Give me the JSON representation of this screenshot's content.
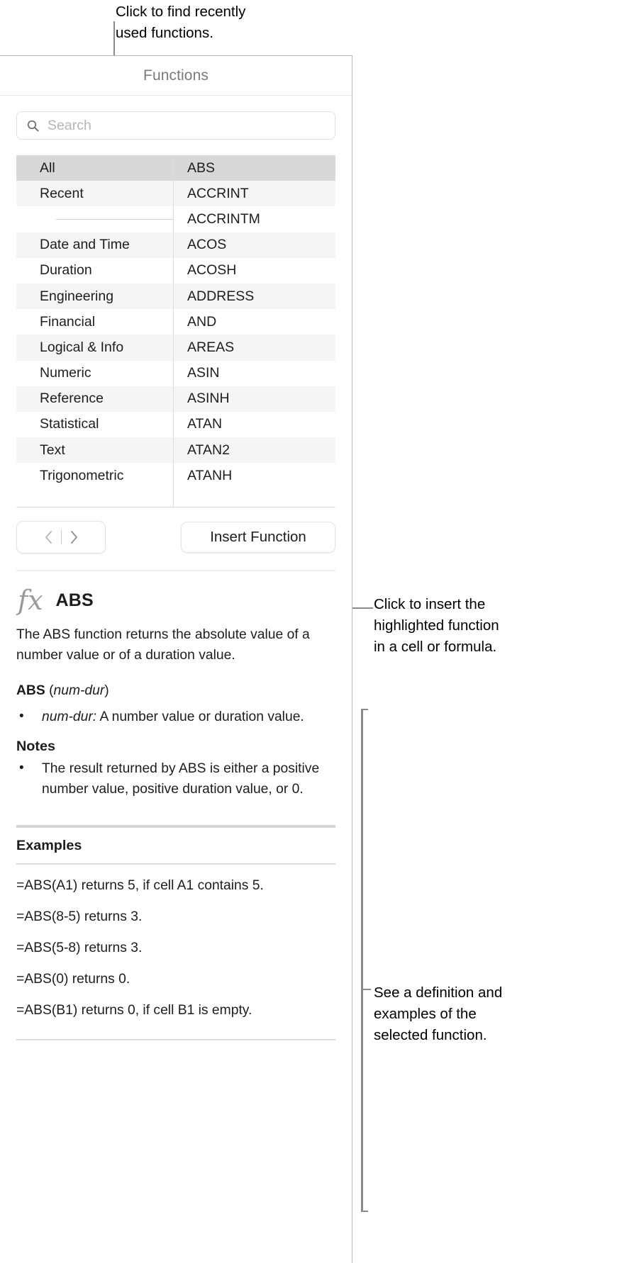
{
  "callouts": [
    {
      "id": "recent",
      "text": "Click to find recently\nused functions."
    },
    {
      "id": "insert",
      "text": "Click to insert the\nhighlighted function\nin a cell or formula."
    },
    {
      "id": "definition",
      "text": "See a definition and\nexamples of the\nselected function."
    }
  ],
  "panel": {
    "title": "Functions",
    "search": {
      "placeholder": "Search",
      "value": "",
      "icon": "search-icon"
    },
    "categories": [
      {
        "label": "All",
        "selected": true
      },
      {
        "label": "Recent",
        "selected": false
      },
      {
        "label": "",
        "separator": true
      },
      {
        "label": "Date and Time",
        "selected": false
      },
      {
        "label": "Duration",
        "selected": false
      },
      {
        "label": "Engineering",
        "selected": false
      },
      {
        "label": "Financial",
        "selected": false
      },
      {
        "label": "Logical & Info",
        "selected": false
      },
      {
        "label": "Numeric",
        "selected": false
      },
      {
        "label": "Reference",
        "selected": false
      },
      {
        "label": "Statistical",
        "selected": false
      },
      {
        "label": "Text",
        "selected": false
      },
      {
        "label": "Trigonometric",
        "selected": false
      }
    ],
    "functions": [
      {
        "label": "ABS",
        "selected": true
      },
      {
        "label": "ACCRINT",
        "selected": false
      },
      {
        "label": "ACCRINTM",
        "selected": false
      },
      {
        "label": "ACOS",
        "selected": false
      },
      {
        "label": "ACOSH",
        "selected": false
      },
      {
        "label": "ADDRESS",
        "selected": false
      },
      {
        "label": "AND",
        "selected": false
      },
      {
        "label": "AREAS",
        "selected": false
      },
      {
        "label": "ASIN",
        "selected": false
      },
      {
        "label": "ASINH",
        "selected": false
      },
      {
        "label": "ATAN",
        "selected": false
      },
      {
        "label": "ATAN2",
        "selected": false
      },
      {
        "label": "ATANH",
        "selected": false
      }
    ],
    "nav": {
      "back_icon": "chevron-left-icon",
      "forward_icon": "chevron-right-icon"
    },
    "insert_button_label": "Insert Function"
  },
  "detail": {
    "fx_icon": "fx-icon",
    "function_name": "ABS",
    "description": "The ABS function returns the absolute value of a number value or of a duration value.",
    "syntax": {
      "name": "ABS",
      "args": "num-dur"
    },
    "arguments": [
      {
        "name": "num-dur:",
        "description": "A number value or duration value."
      }
    ],
    "notes_heading": "Notes",
    "notes": [
      "The result returned by ABS is either a positive number value, positive duration value, or 0."
    ],
    "examples_heading": "Examples",
    "examples": [
      "=ABS(A1) returns 5, if cell A1 contains 5.",
      "=ABS(8-5) returns 3.",
      "=ABS(5-8) returns 3.",
      "=ABS(0) returns 0.",
      "=ABS(B1) returns 0, if cell B1 is empty."
    ]
  },
  "colors": {
    "selected_row": "#d8d8d8",
    "alt_row": "#f5f5f5",
    "panel_border": "#b9b9b9",
    "leader_line": "#8a8a8a",
    "placeholder_text": "#b5b5b5",
    "title_text": "#7a7a7a"
  }
}
